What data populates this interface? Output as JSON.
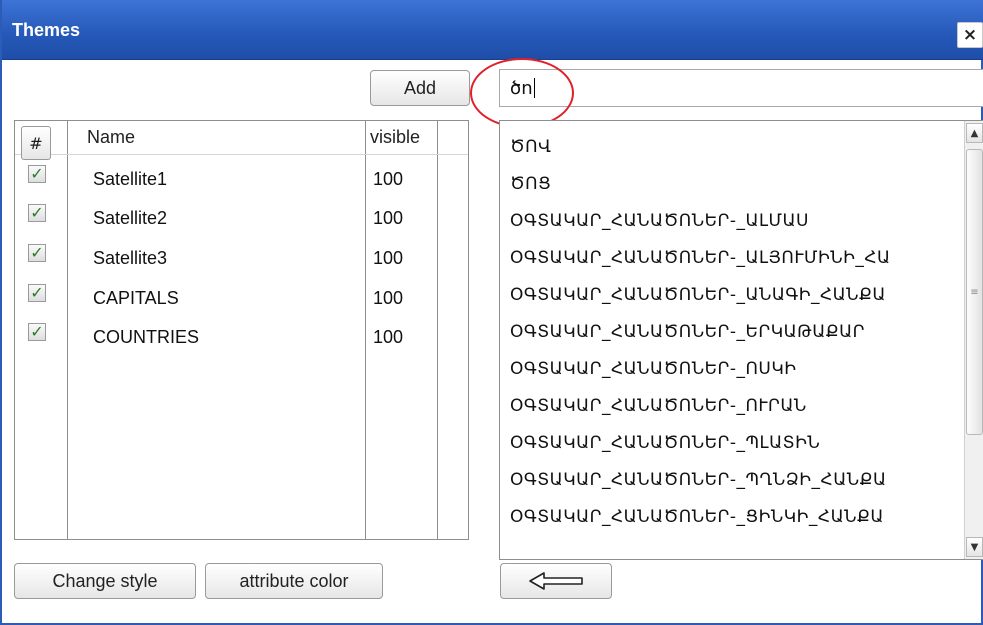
{
  "window": {
    "title": "Themes",
    "close_symbol": "×"
  },
  "toolbar": {
    "add_label": "Add"
  },
  "search": {
    "value": "ծn"
  },
  "table": {
    "columns": [
      "#",
      "Name",
      "visible"
    ],
    "rows": [
      {
        "checked": true,
        "name": "Satellite1",
        "visible": "100"
      },
      {
        "checked": true,
        "name": "Satellite2",
        "visible": "100"
      },
      {
        "checked": true,
        "name": "Satellite3",
        "visible": "100"
      },
      {
        "checked": true,
        "name": "CAPITALS",
        "visible": "100"
      },
      {
        "checked": true,
        "name": "COUNTRIES",
        "visible": "100"
      }
    ]
  },
  "list": {
    "items": [
      "ԾՈՎ",
      "ԾՈՑ",
      "ՕԳՏԱԿԱՐ_ՀԱՆԱԾՈՆԵՐ-_ԱԼՄԱՍ",
      "ՕԳՏԱԿԱՐ_ՀԱՆԱԾՈՆԵՐ-_ԱԼՅՈՒՄԻՆԻ_ՀԱ",
      "ՕԳՏԱԿԱՐ_ՀԱՆԱԾՈՆԵՐ-_ԱՆԱԳԻ_ՀԱՆՔԱ",
      "ՕԳՏԱԿԱՐ_ՀԱՆԱԾՈՆԵՐ-_ԵՐԿԱԹԱՔԱՐ",
      "ՕԳՏԱԿԱՐ_ՀԱՆԱԾՈՆԵՐ-_ՈՍԿԻ",
      "ՕԳՏԱԿԱՐ_ՀԱՆԱԾՈՆԵՐ-_ՈՒՐԱՆ",
      "ՕԳՏԱԿԱՐ_ՀԱՆԱԾՈՆԵՐ-_ՊԼԱՏԻՆ",
      "ՕԳՏԱԿԱՐ_ՀԱՆԱԾՈՆԵՐ-_ՊՂՆՁԻ_ՀԱՆՔԱ",
      "ՕԳՏԱԿԱՐ_ՀԱՆԱԾՈՆԵՐ-_ՑԻՆԿԻ_ՀԱՆՔԱ"
    ]
  },
  "buttons": {
    "change_style": "Change style",
    "attribute_color": "attribute color"
  },
  "icons": {
    "back": "left-arrow-icon",
    "scroll_up": "chevron-up-icon",
    "scroll_down": "chevron-down-icon"
  },
  "colors": {
    "titlebar": "#2558b8",
    "highlight": "#e0202a",
    "check": "#2c7a2c"
  }
}
